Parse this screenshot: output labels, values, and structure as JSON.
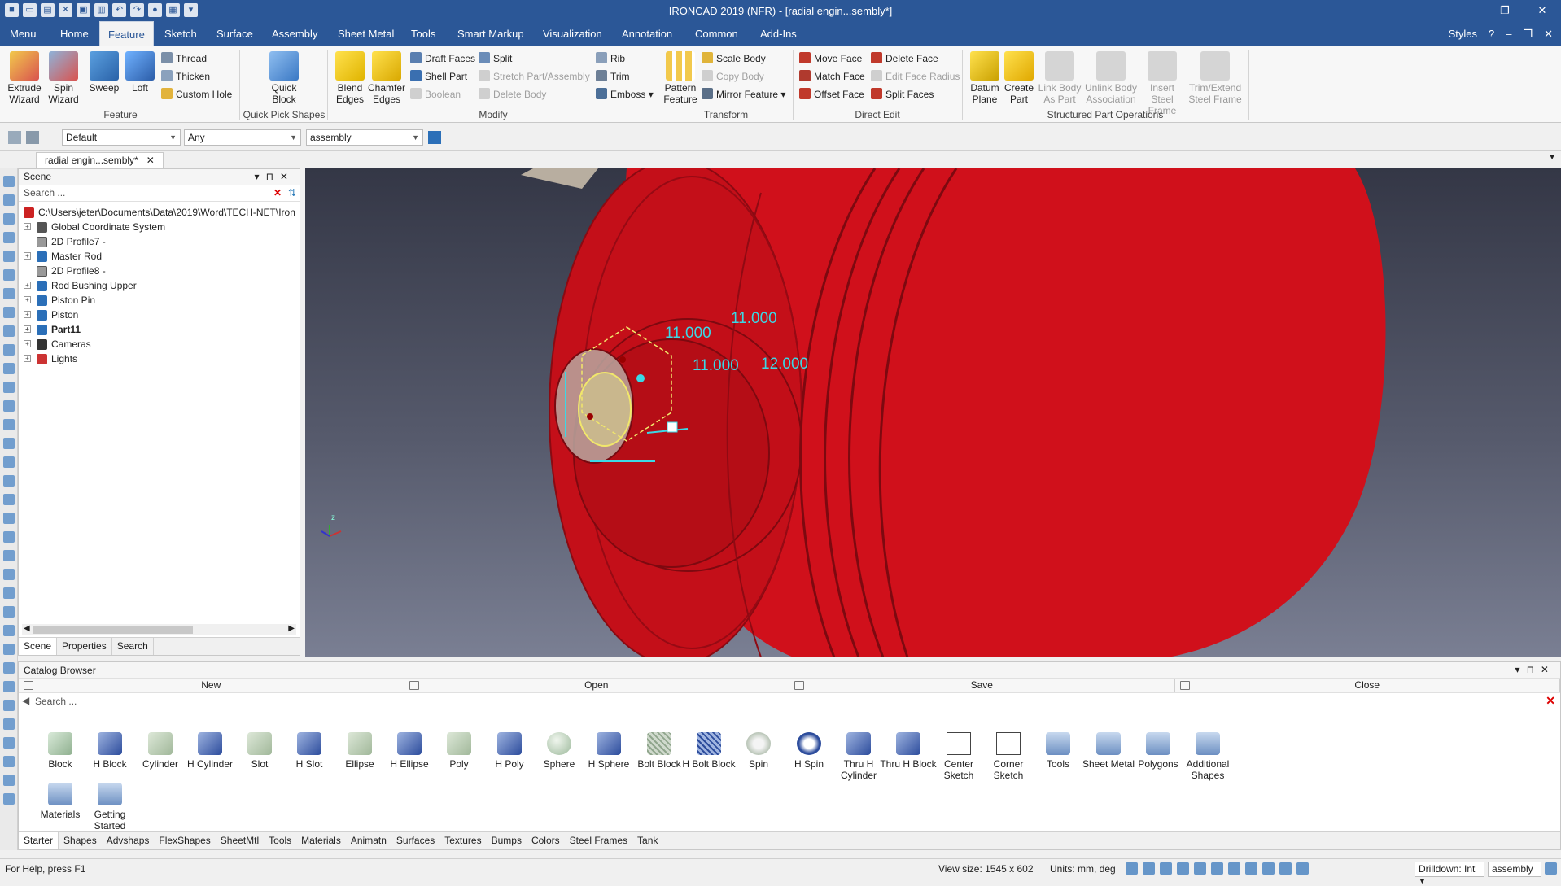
{
  "window": {
    "title": "IRONCAD 2019 (NFR) - [radial engin...sembly*]",
    "controls": [
      "–",
      "❐",
      "✕"
    ]
  },
  "menu": {
    "tabs": [
      "Menu",
      "Home",
      "Feature",
      "Sketch",
      "Surface",
      "Assembly",
      "Sheet Metal",
      "Tools",
      "Smart Markup",
      "Visualization",
      "Annotation",
      "Common",
      "Add-Ins"
    ],
    "active": "Feature",
    "styles_label": "Styles"
  },
  "ribbon": {
    "feature": {
      "group_label": "Feature",
      "extrude": "Extrude Wizard",
      "spin": "Spin Wizard",
      "sweep": "Sweep",
      "loft": "Loft",
      "thread": "Thread",
      "thicken": "Thicken",
      "custom_hole": "Custom Hole"
    },
    "quick_pick": {
      "group_label": "Quick Pick Shapes",
      "quick_block": "Quick Block"
    },
    "modify": {
      "group_label": "Modify",
      "blend_edges": "Blend Edges",
      "chamfer_edges": "Chamfer Edges",
      "draft_faces": "Draft Faces",
      "shell_part": "Shell Part",
      "boolean": "Boolean",
      "split": "Split",
      "stretch": "Stretch Part/Assembly",
      "delete_body": "Delete Body",
      "rib": "Rib",
      "trim": "Trim",
      "emboss": "Emboss"
    },
    "transform": {
      "group_label": "Transform",
      "pattern_feature": "Pattern Feature",
      "scale_body": "Scale Body",
      "copy_body": "Copy Body",
      "mirror_feature": "Mirror Feature"
    },
    "direct_edit": {
      "group_label": "Direct Edit",
      "move_face": "Move Face",
      "match_face": "Match Face",
      "offset_face": "Offset Face",
      "delete_face": "Delete Face",
      "edit_face_radius": "Edit Face Radius",
      "split_faces": "Split Faces"
    },
    "structured": {
      "group_label": "Structured Part Operations",
      "datum_plane": "Datum Plane",
      "create_part": "Create Part",
      "link_body": "Link Body As Part",
      "unlink_body": "Unlink Body Association",
      "insert_steel": "Insert Steel Frame",
      "trim_extend": "Trim/Extend Steel Frame"
    }
  },
  "toolbar2": {
    "style_combo": "Default",
    "filter_combo": "Any",
    "level_combo": "assembly"
  },
  "document_tab": {
    "label": "radial engin...sembly*"
  },
  "scene": {
    "title": "Scene",
    "search_placeholder": "Search ...",
    "root_path": "C:\\Users\\jeter\\Documents\\Data\\2019\\Word\\TECH-NET\\Iron",
    "nodes": [
      "Global Coordinate System",
      "2D Profile7 -",
      "Master Rod",
      "2D Profile8 -",
      "Rod Bushing Upper",
      "Piston Pin",
      "Piston",
      "Part11",
      "Cameras",
      "Lights"
    ],
    "tabs": [
      "Scene",
      "Properties",
      "Search"
    ]
  },
  "viewport": {
    "dimensions": [
      "11.000",
      "11.000",
      "11.000",
      "12.000"
    ],
    "triad_z": "z"
  },
  "catalog": {
    "title": "Catalog Browser",
    "actions": [
      "New",
      "Open",
      "Save",
      "Close"
    ],
    "search_placeholder": "Search ...",
    "items": [
      "Block",
      "H Block",
      "Cylinder",
      "H Cylinder",
      "Slot",
      "H Slot",
      "Ellipse",
      "H Ellipse",
      "Poly",
      "H Poly",
      "Sphere",
      "H Sphere",
      "Bolt Block",
      "H Bolt Block",
      "Spin",
      "H Spin",
      "Thru H Cylinder",
      "Thru H Block",
      "Center Sketch",
      "Corner Sketch",
      "Tools",
      "Sheet Metal",
      "Polygons",
      "Additional Shapes",
      "Materials",
      "Getting Started"
    ],
    "tabs": [
      "Starter",
      "Shapes",
      "Advshaps",
      "FlexShapes",
      "SheetMtl",
      "Tools",
      "Materials",
      "Animatn",
      "Surfaces",
      "Textures",
      "Bumps",
      "Colors",
      "Steel Frames",
      "Tank"
    ]
  },
  "status": {
    "help": "For Help, press F1",
    "view_size": "View size: 1545 x  602",
    "units": "Units: mm, deg",
    "drilldown": "Drilldown: Int",
    "level": "assembly"
  }
}
